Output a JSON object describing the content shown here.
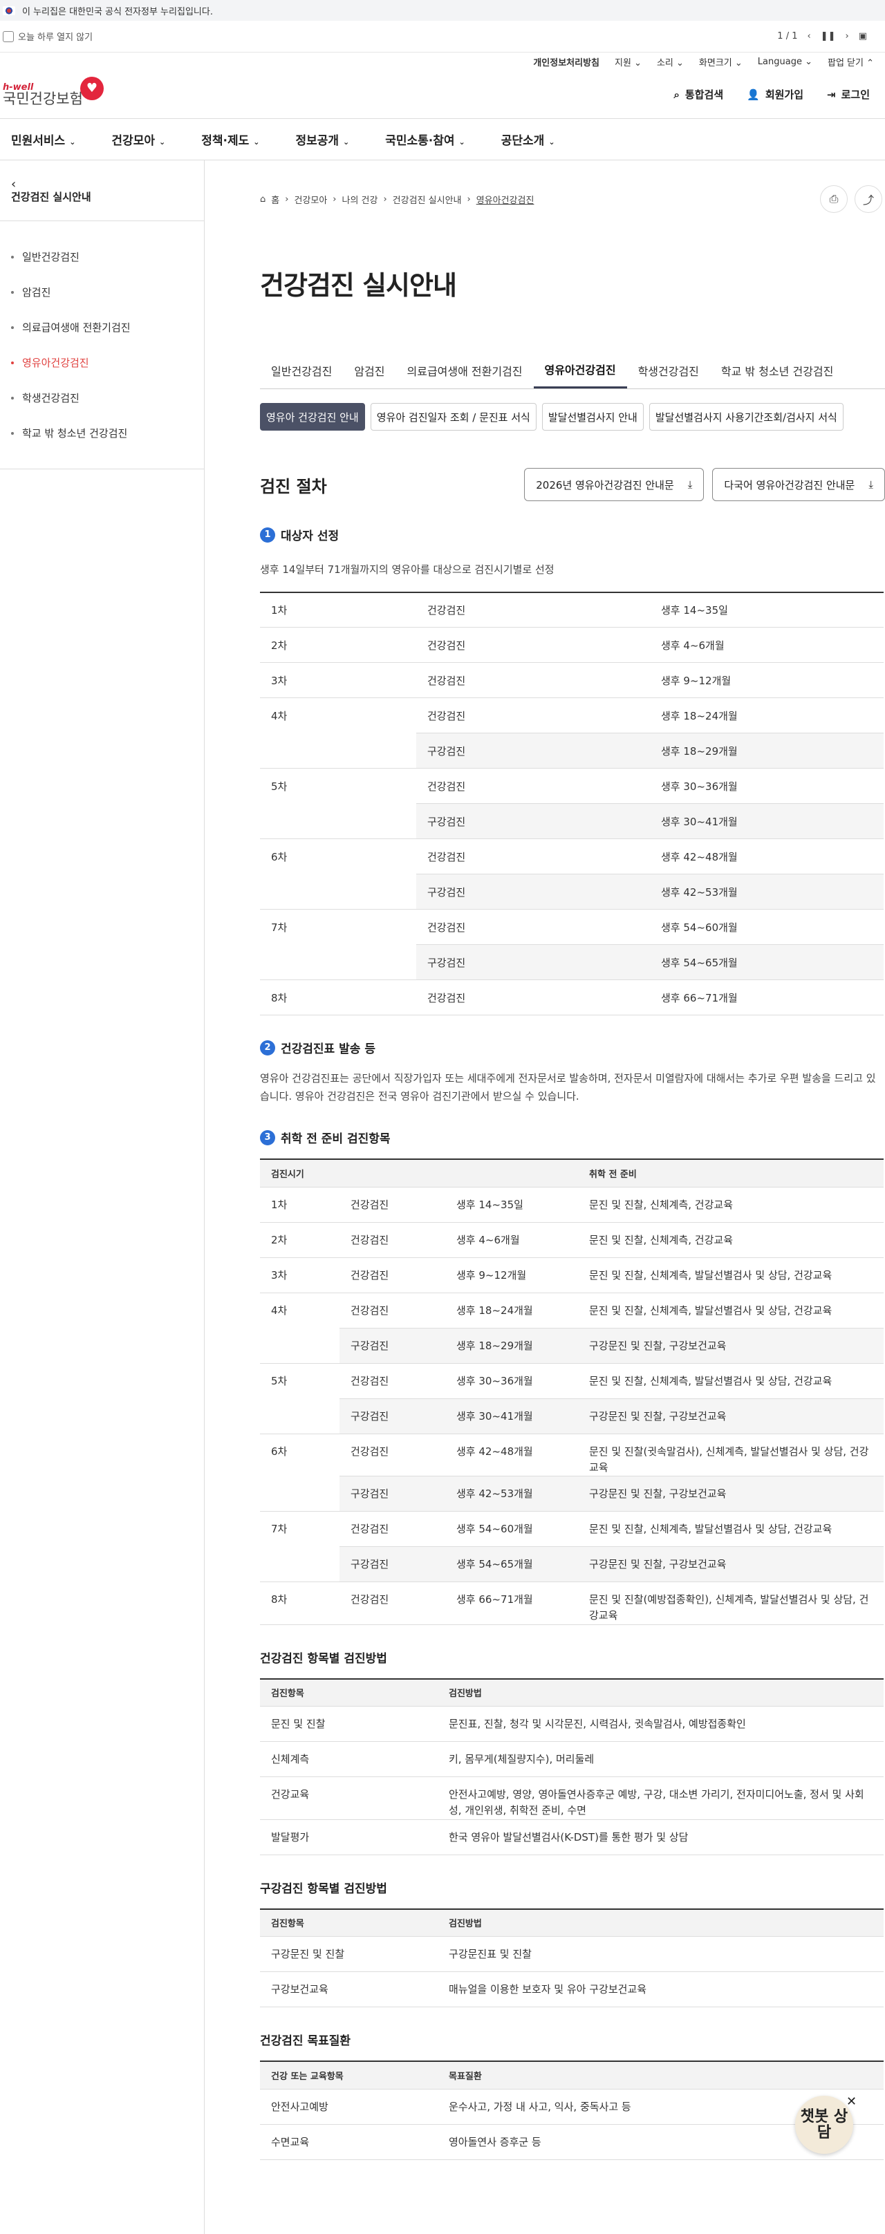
{
  "gov_notice": "이 누리집은 대한민국 공식 전자정부 누리집입니다.",
  "popup": {
    "today_close": "오늘 하루 열지 않기",
    "page": "1",
    "total": "1",
    "close": "팝업 닫기"
  },
  "util": [
    "개인정보처리방침",
    "지원",
    "소리",
    "화면크기",
    "Language"
  ],
  "logo": {
    "en": "h-well",
    "ko": "국민건강보험"
  },
  "header_buttons": [
    "통합검색",
    "회원가입",
    "로그인"
  ],
  "gnb": [
    "민원서비스",
    "건강모아",
    "정책·제도",
    "정보공개",
    "국민소통·참여",
    "공단소개"
  ],
  "side": {
    "title": "건강검진 실시안내",
    "items": [
      "일반건강검진",
      "암검진",
      "의료급여생애 전환기검진",
      "영유아건강검진",
      "학생건강검진",
      "학교 밖 청소년 건강검진"
    ],
    "active": 3
  },
  "breadcrumb": [
    "홈",
    "건강모아",
    "나의 건강",
    "건강검진 실시안내",
    "영유아건강검진"
  ],
  "page_title": "건강검진 실시안내",
  "tabs": [
    "일반건강검진",
    "암검진",
    "의료급여생애 전환기검진",
    "영유아건강검진",
    "학생건강검진",
    "학교 밖 청소년 건강검진"
  ],
  "subtabs": [
    "영유아 건강검진 안내",
    "영유아 검진일자 조회 / 문진표 서식",
    "발달선별검사지 안내",
    "발달선별검사지 사용기간조회/검사지 서식"
  ],
  "section_title": "검진 절차",
  "downloads": [
    "2026년 영유아건강검진 안내문",
    "다국어 영유아건강검진 안내문"
  ],
  "s1": {
    "num": "1",
    "title": "대상자 선정",
    "desc": "생후 14일부터 71개월까지의 영유아를 대상으로 검진시기별로 선정",
    "rows": [
      [
        "1차",
        "건강검진",
        "생후 14~35일"
      ],
      [
        "2차",
        "건강검진",
        "생후 4~6개월"
      ],
      [
        "3차",
        "건강검진",
        "생후 9~12개월"
      ],
      [
        "4차",
        "건강검진",
        "생후 18~24개월"
      ],
      [
        "",
        "구강검진",
        "생후 18~29개월"
      ],
      [
        "5차",
        "건강검진",
        "생후 30~36개월"
      ],
      [
        "",
        "구강검진",
        "생후 30~41개월"
      ],
      [
        "6차",
        "건강검진",
        "생후 42~48개월"
      ],
      [
        "",
        "구강검진",
        "생후 42~53개월"
      ],
      [
        "7차",
        "건강검진",
        "생후 54~60개월"
      ],
      [
        "",
        "구강검진",
        "생후 54~65개월"
      ],
      [
        "8차",
        "건강검진",
        "생후 66~71개월"
      ]
    ]
  },
  "s2": {
    "num": "2",
    "title": "건강검진표 발송 등",
    "desc": "영유아 건강검진표는 공단에서 직장가입자 또는 세대주에게 전자문서로 발송하며, 전자문서 미열람자에 대해서는 추가로 우편 발송을 드리고 있습니다. 영유아 건강검진은 전국 영유아 검진기관에서 받으실 수 있습니다."
  },
  "s3": {
    "num": "3",
    "title": "취학 전 준비 검진항목",
    "headers": [
      "검진시기",
      "취학 전 준비"
    ],
    "rows": [
      [
        "1차",
        "건강검진",
        "생후 14~35일",
        "문진 및 진찰, 신체계측, 건강교육"
      ],
      [
        "2차",
        "건강검진",
        "생후 4~6개월",
        "문진 및 진찰, 신체계측, 건강교육"
      ],
      [
        "3차",
        "건강검진",
        "생후 9~12개월",
        "문진 및 진찰, 신체계측, 발달선별검사 및 상담, 건강교육"
      ],
      [
        "4차",
        "건강검진",
        "생후 18~24개월",
        "문진 및 진찰, 신체계측, 발달선별검사 및 상담, 건강교육"
      ],
      [
        "",
        "구강검진",
        "생후 18~29개월",
        "구강문진 및 진찰, 구강보건교육"
      ],
      [
        "5차",
        "건강검진",
        "생후 30~36개월",
        "문진 및 진찰, 신체계측, 발달선별검사 및 상담, 건강교육"
      ],
      [
        "",
        "구강검진",
        "생후 30~41개월",
        "구강문진 및 진찰, 구강보건교육"
      ],
      [
        "6차",
        "건강검진",
        "생후 42~48개월",
        "문진 및 진찰(귓속말검사), 신체계측, 발달선별검사 및 상담, 건강교육"
      ],
      [
        "",
        "구강검진",
        "생후 42~53개월",
        "구강문진 및 진찰, 구강보건교육"
      ],
      [
        "7차",
        "건강검진",
        "생후 54~60개월",
        "문진 및 진찰, 신체계측, 발달선별검사 및 상담, 건강교육"
      ],
      [
        "",
        "구강검진",
        "생후 54~65개월",
        "구강문진 및 진찰, 구강보건교육"
      ],
      [
        "8차",
        "건강검진",
        "생후 66~71개월",
        "문진 및 진찰(예방접종확인), 신체계측, 발달선별검사 및 상담, 건강교육"
      ]
    ]
  },
  "t4": {
    "title": "건강검진 항목별 검진방법",
    "headers": [
      "검진항목",
      "검진방법"
    ],
    "rows": [
      [
        "문진 및 진찰",
        "문진표, 진찰, 청각 및 시각문진, 시력검사, 귓속말검사, 예방접종확인"
      ],
      [
        "신체계측",
        "키, 몸무게(체질량지수), 머리둘레"
      ],
      [
        "건강교육",
        "안전사고예방, 영양, 영아돌연사증후군 예방, 구강, 대소변 가리기, 전자미디어노출, 정서 및 사회성, 개인위생, 취학전 준비, 수면"
      ],
      [
        "발달평가",
        "한국 영유아 발달선별검사(K-DST)를 통한 평가 및 상담"
      ]
    ]
  },
  "t5": {
    "title": "구강검진 항목별 검진방법",
    "headers": [
      "검진항목",
      "검진방법"
    ],
    "rows": [
      [
        "구강문진 및 진찰",
        "구강문진표 및 진찰"
      ],
      [
        "구강보건교육",
        "매뉴얼을 이용한 보호자 및 유아 구강보건교육"
      ]
    ]
  },
  "t6": {
    "title": "건강검진 목표질환",
    "headers": [
      "건강 또는 교육항목",
      "목표질환"
    ],
    "rows": [
      [
        "안전사고예방",
        "운수사고, 가정 내 사고, 익사, 중독사고 등"
      ],
      [
        "수면교육",
        "영아돌연사 증후군 등"
      ]
    ]
  },
  "chatbot": "챗봇 상담"
}
